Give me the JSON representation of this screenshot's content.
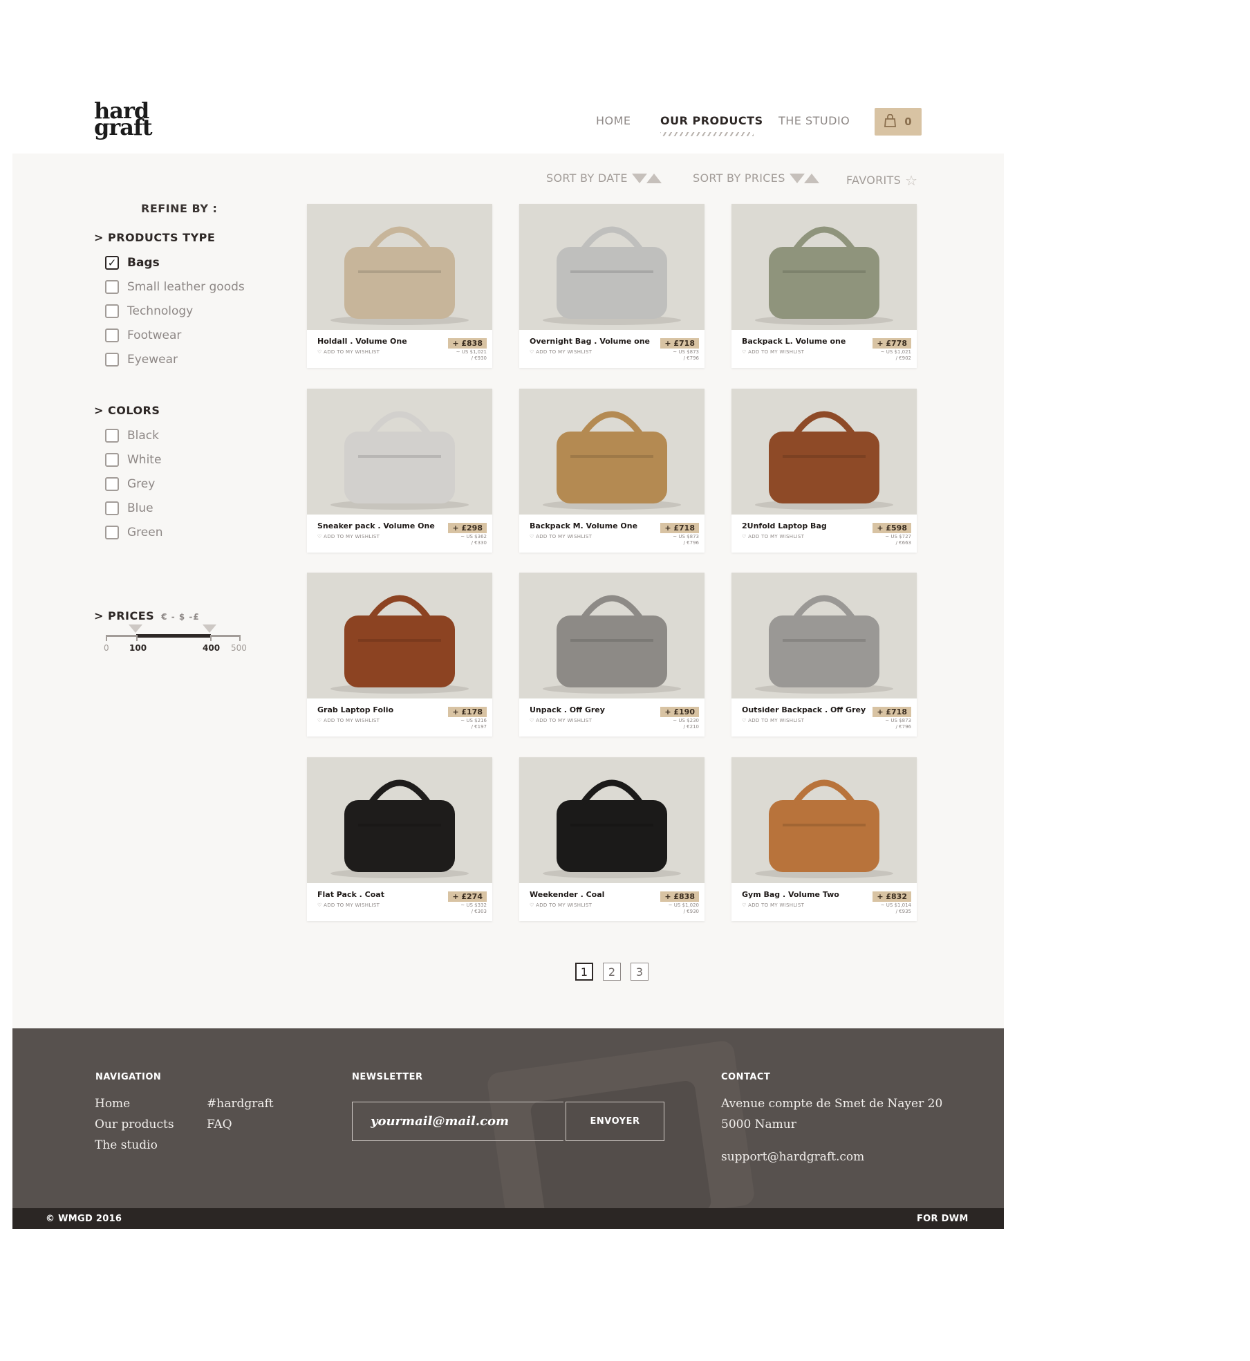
{
  "brand": {
    "line1": "hard",
    "line2": "graft"
  },
  "nav": {
    "items": [
      {
        "label": "HOME"
      },
      {
        "label": "OUR PRODUCTS"
      },
      {
        "label": "THE STUDIO"
      }
    ],
    "cart_count": "0",
    "cart_icon": "shopping-bag-icon"
  },
  "sort": {
    "by_date": "SORT BY DATE",
    "by_prices": "SORT BY PRICES",
    "favorites": "FAVORITS",
    "favorites_icon": "star-outline-icon"
  },
  "sidebar": {
    "refine_label": "REFINE BY :",
    "products_type": {
      "title": "> PRODUCTS TYPE",
      "options": [
        {
          "label": "Bags",
          "checked": true
        },
        {
          "label": "Small leather goods",
          "checked": false
        },
        {
          "label": "Technology",
          "checked": false
        },
        {
          "label": "Footwear",
          "checked": false
        },
        {
          "label": "Eyewear",
          "checked": false
        }
      ]
    },
    "colors": {
      "title": "> COLORS",
      "options": [
        {
          "label": "Black",
          "checked": false
        },
        {
          "label": "White",
          "checked": false
        },
        {
          "label": "Grey",
          "checked": false
        },
        {
          "label": "Blue",
          "checked": false
        },
        {
          "label": "Green",
          "checked": false
        }
      ]
    },
    "prices": {
      "title": "> PRICES",
      "currencies": "€ - $ -£",
      "min": "0",
      "low": "100",
      "high": "400",
      "max": "500"
    }
  },
  "products": [
    {
      "name": "Holdall . Volume One",
      "price": "+ £838",
      "usd": "~ US $1,021",
      "eur": "/ €930",
      "wishlist": "ADD TO MY WISHLIST",
      "color": "#c7b59a"
    },
    {
      "name": "Overnight Bag . Volume one",
      "price": "+ £718",
      "usd": "~ US $873",
      "eur": "/ €796",
      "wishlist": "ADD TO MY WISHLIST",
      "color": "#bfbfbd"
    },
    {
      "name": "Backpack L. Volume one",
      "price": "+ £778",
      "usd": "~ US $1,021",
      "eur": "/ €902",
      "wishlist": "ADD TO MY WISHLIST",
      "color": "#8f947c"
    },
    {
      "name": "Sneaker pack . Volume One",
      "price": "+ £298",
      "usd": "~ US $362",
      "eur": "/ €330",
      "wishlist": "ADD TO MY WISHLIST",
      "color": "#d2d0cd"
    },
    {
      "name": "Backpack M. Volume One",
      "price": "+ £718",
      "usd": "~ US $873",
      "eur": "/ €796",
      "wishlist": "ADD TO MY WISHLIST",
      "color": "#b48a52"
    },
    {
      "name": "2Unfold Laptop Bag",
      "price": "+ £598",
      "usd": "~ US $727",
      "eur": "/ €663",
      "wishlist": "ADD TO MY WISHLIST",
      "color": "#8e4a27"
    },
    {
      "name": "Grab Laptop Folio",
      "price": "+ £178",
      "usd": "~ US $216",
      "eur": "/ €197",
      "wishlist": "ADD TO MY WISHLIST",
      "color": "#8c4322"
    },
    {
      "name": "Unpack . Off Grey",
      "price": "+ £190",
      "usd": "~ US $230",
      "eur": "/ €210",
      "wishlist": "ADD TO MY WISHLIST",
      "color": "#8d8a86"
    },
    {
      "name": "Outsider Backpack . Off Grey",
      "price": "+ £718",
      "usd": "~ US $873",
      "eur": "/ €796",
      "wishlist": "ADD TO MY WISHLIST",
      "color": "#9a9895"
    },
    {
      "name": "Flat Pack . Coat",
      "price": "+ £274",
      "usd": "~ US $332",
      "eur": "/ €303",
      "wishlist": "ADD TO MY WISHLIST",
      "color": "#1e1c1b"
    },
    {
      "name": "Weekender . Coal",
      "price": "+ £838",
      "usd": "~ US $1,020",
      "eur": "/ €930",
      "wishlist": "ADD TO MY WISHLIST",
      "color": "#1b1a19"
    },
    {
      "name": "Gym Bag . Volume Two",
      "price": "+ £832",
      "usd": "~ US $1,014",
      "eur": "/ €935",
      "wishlist": "ADD TO MY WISHLIST",
      "color": "#b8733b"
    }
  ],
  "pagination": [
    "1",
    "2",
    "3"
  ],
  "footer": {
    "navigation_title": "NAVIGATION",
    "nav_links": [
      "Home",
      "Our products",
      "The studio"
    ],
    "extra_links": [
      "#hardgraft",
      "FAQ"
    ],
    "newsletter_title": "NEWSLETTER",
    "newsletter_placeholder": "yourmail@mail.com",
    "newsletter_button": "ENVOYER",
    "contact_title": "CONTACT",
    "address_line1": "Avenue compte de Smet de Nayer 20",
    "address_line2": "5000 Namur",
    "email": "support@hardgraft.com",
    "copyright": "© WMGD 2016",
    "credit": "FOR DWM"
  },
  "colors": {
    "accent": "#d8c3a3",
    "panel_bg": "#f8f7f5",
    "footer_bg": "#57514e",
    "footer_bar": "#2b2624"
  }
}
